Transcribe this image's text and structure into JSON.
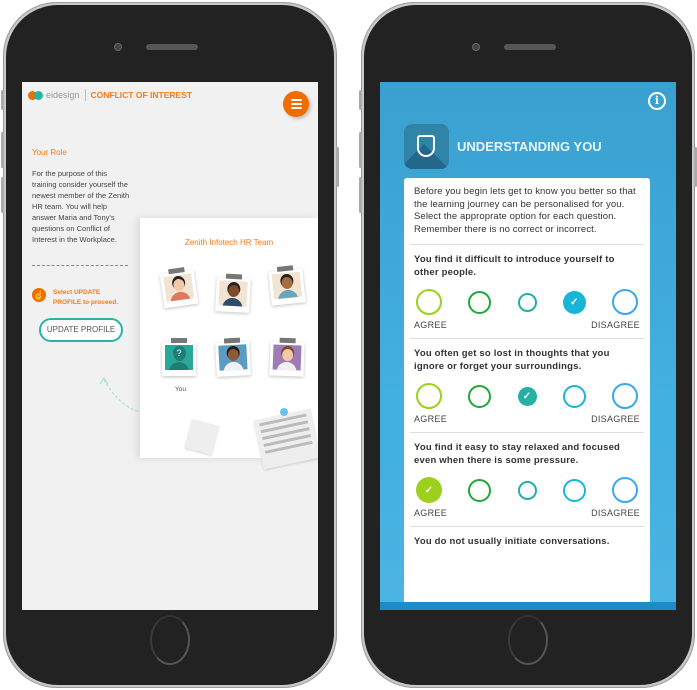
{
  "left_phone": {
    "header": {
      "logo_text": "eidesign",
      "title": "CONFLICT OF INTEREST",
      "logo_colors": [
        "#ef6c00",
        "#26b5a5"
      ],
      "menu_icon": "hamburger-icon"
    },
    "role": {
      "title": "Your Role",
      "text": "For the purpose of this training consider yourself the newest member of the Zenith HR team. You will help answer Maria and Tony's questions on Conflict of Interest in the Workplace."
    },
    "hint": {
      "icon": "pointer-hand-icon",
      "text": "Select UPDATE PROFILE to proceed."
    },
    "update_button_label": "UPDATE PROFILE",
    "team": {
      "title": "Zenith Infotech HR Team",
      "members": [
        {
          "name": "member-1",
          "bg": "#f3e3d2",
          "skin": "#f2c9a5",
          "hair": "#222222",
          "shirt": "#e07860"
        },
        {
          "name": "member-2",
          "bg": "#f3e3d2",
          "skin": "#7a4a2a",
          "hair": "#222222",
          "shirt": "#2f4c6e"
        },
        {
          "name": "member-3",
          "bg": "#f3e3d2",
          "skin": "#a86b3f",
          "hair": "#222222",
          "shirt": "#6aa6b8"
        },
        {
          "name": "you",
          "bg": "#2aa79b",
          "skin": "#1f7d73",
          "hair": "#1f7d73",
          "shirt": "#1f7d73",
          "label": "You",
          "mark": "?"
        },
        {
          "name": "member-5",
          "bg": "#5b9cc4",
          "skin": "#8a5a3a",
          "hair": "#2a1a10",
          "shirt": "#f2f2f2"
        },
        {
          "name": "member-6",
          "bg": "#a17bb5",
          "skin": "#f2c9a5",
          "hair": "#7a4a2a",
          "shirt": "#f2f2f2"
        }
      ]
    }
  },
  "right_phone": {
    "info_icon": "info-icon",
    "badge_icon": "shield-person-icon",
    "title": "UNDERSTANDING YOU",
    "intro": "Before you begin lets get to know you better so that the learning journey can be personalised for you. Select the approprate option for each question. Remember there is no correct or incorrect.",
    "scale": {
      "agree_label": "AGREE",
      "disagree_label": "DISAGREE",
      "colors": [
        "#9bd11c",
        "#1fa83a",
        "#25b0a6",
        "#19b5d6",
        "#3aa8ee"
      ]
    },
    "questions": [
      {
        "text": "You find it difficult to introduce yourself to other people.",
        "selected": 4
      },
      {
        "text": "You often get so lost in thoughts that you ignore or forget your surroundings.",
        "selected": 3
      },
      {
        "text": "You find it easy to stay relaxed and focused even when there is some pressure.",
        "selected": 1
      },
      {
        "text": "You do not usually initiate conversations.",
        "selected": null
      }
    ],
    "check_glyph": "✓"
  }
}
